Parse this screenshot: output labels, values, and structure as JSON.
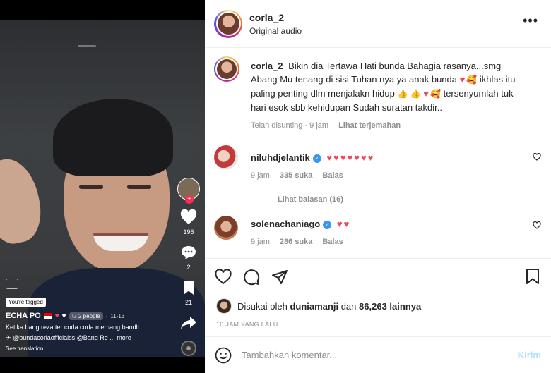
{
  "video": {
    "rail": {
      "likes": "196",
      "comments": "2",
      "saves": "21"
    },
    "tag_badge": "You're tagged",
    "author": "ECHA PO",
    "people_chip": "2 people",
    "date": "11-13",
    "caption_line1": "Ketika bang reza ter corla corla memang bandlt",
    "caption_line2": "@bundacorlaofficialss @Bang Re ...",
    "caption_more": "more",
    "see_translation": "See translation"
  },
  "header": {
    "username": "corla_2",
    "audio": "Original audio"
  },
  "caption": {
    "username": "corla_2",
    "text_1": "Bikin dia Tertawa Hati bunda Bahagia rasanya...smg Abang Mu tenang di sisi Tuhan nya ya anak bunda",
    "text_2": "ikhlas itu paling penting dlm menjalakn hidup",
    "text_3": "tersenyumlah tuk hari esok sbb kehidupan Sudah suratan takdir..",
    "edited": "Telah disunting · 9 jam",
    "see_translation": "Lihat terjemahan"
  },
  "comments": [
    {
      "username": "niluhdjelantik",
      "text": "♥♥♥♥♥♥♥",
      "time": "9 jam",
      "likes": "335 suka",
      "reply": "Balas",
      "view_replies": "Lihat balasan (16)"
    },
    {
      "username": "solenachaniago",
      "text": "♥♥",
      "time": "9 jam",
      "likes": "286 suka",
      "reply": "Balas"
    }
  ],
  "actions": {
    "liked_by_prefix": "Disukai oleh",
    "liked_by_user": "duniamanji",
    "liked_by_and": "dan",
    "liked_by_count": "86,263 lainnya",
    "time_ago": "10 JAM YANG LALU",
    "comment_placeholder": "Tambahkan komentar...",
    "post_label": "Kirim"
  },
  "colors": {
    "like_red": "#ed4956",
    "link_blue": "#b2dffc",
    "muted": "#8e8e8e",
    "verified": "#3897f0"
  }
}
